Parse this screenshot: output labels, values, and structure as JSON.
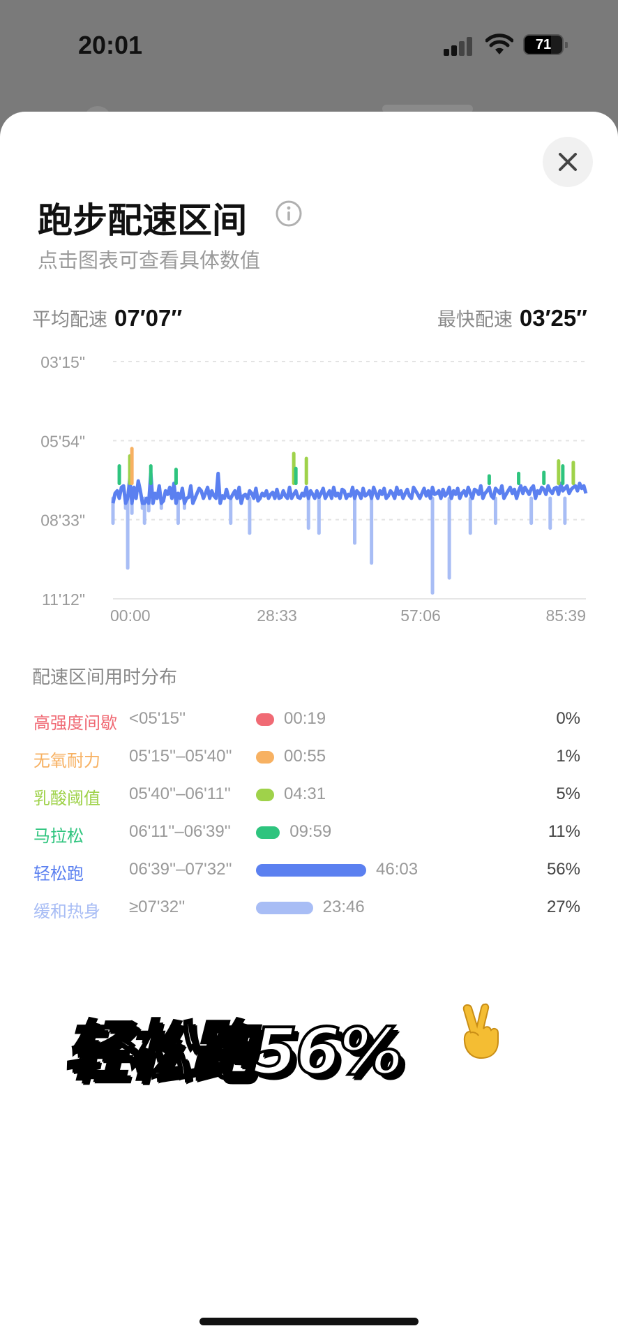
{
  "status_bar": {
    "time": "20:01",
    "battery": "71"
  },
  "header": {
    "title": "跑步配速区间",
    "subtitle": "点击图表可查看具体数值"
  },
  "stats": {
    "avg_label": "平均配速",
    "avg_value": "07′07″",
    "fast_label": "最快配速",
    "fast_value": "03′25″"
  },
  "chart_data": {
    "type": "line",
    "x_tick_labels": [
      "00:00",
      "28:33",
      "57:06",
      "85:39"
    ],
    "y_tick_labels": [
      "03'15\"",
      "05'54\"",
      "08'33\"",
      "11'12\""
    ],
    "ylim_sec_per_km": [
      195,
      672
    ],
    "y_inverted": true,
    "x_range_min": [
      0,
      85.65
    ],
    "grid": true,
    "series": [
      {
        "name": "轻松跑",
        "color": "#5b80f0",
        "values_sec_per_km": [
          510,
          460,
          455,
          470,
          448,
          445,
          490,
          470,
          430,
          500,
          448,
          470,
          435,
          455,
          490,
          520,
          470,
          495,
          420,
          480,
          460,
          470,
          445,
          490,
          475,
          455,
          462,
          448,
          470,
          440,
          480,
          460,
          470,
          450,
          490,
          470,
          468,
          445,
          480,
          470,
          460,
          450,
          455,
          470,
          460,
          448,
          470,
          455,
          465,
          470,
          420,
          480,
          465,
          470,
          452,
          468,
          470,
          462,
          455,
          470,
          448,
          480,
          465,
          462,
          470,
          455,
          460,
          470,
          450,
          475,
          470,
          460,
          465,
          455,
          470,
          462,
          458,
          470,
          452,
          470,
          468,
          455,
          465,
          470,
          448,
          470,
          462,
          455,
          468,
          470,
          460,
          465,
          448,
          470,
          455,
          462,
          470,
          455,
          468,
          460,
          450,
          470,
          462,
          455,
          470,
          448,
          465,
          460,
          470,
          452,
          455,
          470,
          462,
          465,
          448,
          470,
          455,
          460,
          470,
          450,
          465,
          462,
          455,
          470,
          448,
          460,
          470,
          455,
          462,
          450,
          470,
          465,
          455,
          460,
          470,
          448,
          462,
          455,
          470,
          460,
          452,
          465,
          470,
          448,
          455,
          462,
          470,
          460,
          450,
          465,
          455,
          470,
          448,
          462,
          460,
          455,
          470,
          452,
          465,
          460,
          448,
          470,
          455,
          462,
          450,
          470,
          460,
          455,
          465,
          448,
          460,
          470,
          452,
          455,
          462,
          445,
          470,
          460,
          455,
          448,
          465,
          470,
          450,
          455,
          460,
          445,
          470,
          462,
          455,
          448,
          460,
          452,
          470,
          455,
          445,
          460,
          448,
          455,
          462,
          450,
          445,
          470,
          455,
          460,
          448,
          452,
          462,
          445,
          455,
          460,
          450,
          448,
          462,
          440,
          455,
          450,
          445,
          460,
          452,
          448,
          445,
          455,
          440,
          450,
          445,
          460
        ]
      }
    ]
  },
  "zones_section": {
    "title": "配速区间用时分布",
    "zones": [
      {
        "name": "高强度间歇",
        "range": "<05'15''",
        "duration": "00:19",
        "percent": "0%",
        "share": 0.004,
        "color": "#f06a74"
      },
      {
        "name": "无氧耐力",
        "range": "05'15''–05'40''",
        "duration": "00:55",
        "percent": "1%",
        "share": 0.011,
        "color": "#f7b162"
      },
      {
        "name": "乳酸阈值",
        "range": "05'40''–06'11''",
        "duration": "04:31",
        "percent": "5%",
        "share": 0.053,
        "color": "#9fd24a"
      },
      {
        "name": "马拉松",
        "range": "06'11''–06'39''",
        "duration": "09:59",
        "percent": "11%",
        "share": 0.117,
        "color": "#2ec47e"
      },
      {
        "name": "轻松跑",
        "range": "06'39''–07'32''",
        "duration": "46:03",
        "percent": "56%",
        "share": 0.54,
        "color": "#5b80f0"
      },
      {
        "name": "缓和热身",
        "range": "≥07'32''",
        "duration": "23:46",
        "percent": "27%",
        "share": 0.279,
        "color": "#a8bdf5"
      }
    ]
  },
  "overlay_text": "轻松跑56%"
}
